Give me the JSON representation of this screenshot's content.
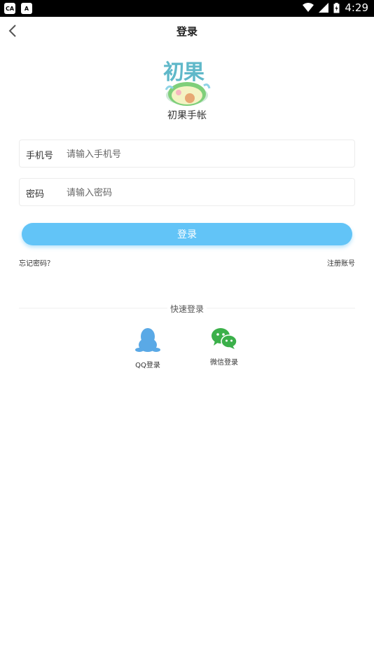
{
  "status_bar": {
    "time": "4:29",
    "left_icons": [
      "ca-notification-icon",
      "a-notification-icon"
    ],
    "right_icons": [
      "wifi-icon",
      "signal-icon",
      "battery-icon"
    ]
  },
  "header": {
    "title": "登录"
  },
  "logo": {
    "text": "初果",
    "app_name": "初果手帐"
  },
  "form": {
    "phone_label": "手机号",
    "phone_placeholder": "请输入手机号",
    "password_label": "密码",
    "password_placeholder": "请输入密码",
    "login_label": "登录"
  },
  "links": {
    "forgot": "忘记密码？",
    "register": "注册账号"
  },
  "quick_login": {
    "title": "快速登录",
    "qq_label": "QQ登录",
    "wechat_label": "微信登录"
  },
  "colors": {
    "accent": "#62c4f7",
    "qq_icon": "#5aa9e6",
    "wechat_icon": "#3bb04a"
  }
}
